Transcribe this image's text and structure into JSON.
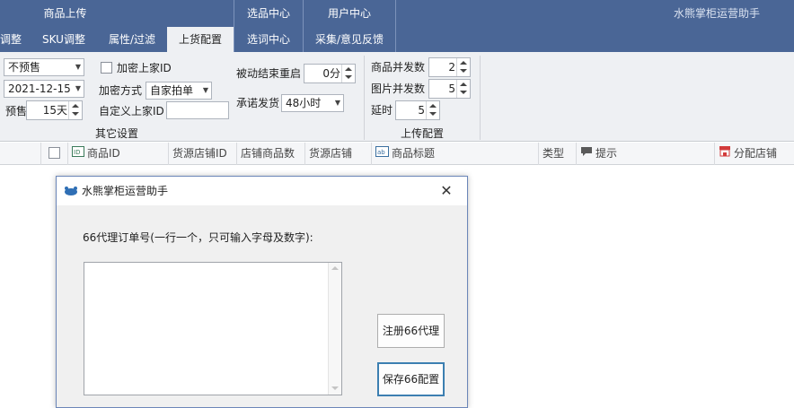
{
  "ribbon": {
    "groups": [
      "商品上传",
      "选品中心",
      "用户中心"
    ],
    "tabs": [
      {
        "label": "调整",
        "active": false
      },
      {
        "label": "SKU调整",
        "active": false
      },
      {
        "label": "属性/过滤",
        "active": false
      },
      {
        "label": "上货配置",
        "active": true
      },
      {
        "label": "选词中心",
        "active": false
      },
      {
        "label": "采集/意见反馈",
        "active": false
      }
    ],
    "app_title": "水熊掌柜运营助手",
    "colors": {
      "header_bg": "#4a6696",
      "ribbon_bg": "#eef0f3"
    }
  },
  "settings": {
    "presale_value": "不预售",
    "date_value": "2021-12-15",
    "presale_days_label": "预售",
    "presale_days_value": "15天",
    "encrypt_checkbox_label": "加密上家ID",
    "encrypt_mode_label": "加密方式",
    "encrypt_mode_value": "自家拍单",
    "custom_id_label": "自定义上家ID",
    "custom_id_value": "",
    "restart_label": "被动结束重启",
    "restart_value": "0分",
    "ship_label": "承诺发货",
    "ship_value": "48小时",
    "group_title": "其它设置"
  },
  "upload": {
    "concurrency_label": "商品并发数",
    "concurrency_value": "2",
    "image_concurrency_label": "图片并发数",
    "image_concurrency_value": "5",
    "delay_label": "延时",
    "delay_value": "5",
    "group_title": "上传配置"
  },
  "table": {
    "columns": [
      "商品ID",
      "货源店铺ID",
      "店铺商品数",
      "货源店铺",
      "商品标题",
      "类型",
      "提示",
      "分配店铺"
    ]
  },
  "dialog": {
    "title": "水熊掌柜运营助手",
    "close": "✕",
    "label": "66代理订单号(一行一个，只可输入字母及数字):",
    "textarea_value": "",
    "register_button": "注册66代理",
    "save_button": "保存66配置"
  }
}
